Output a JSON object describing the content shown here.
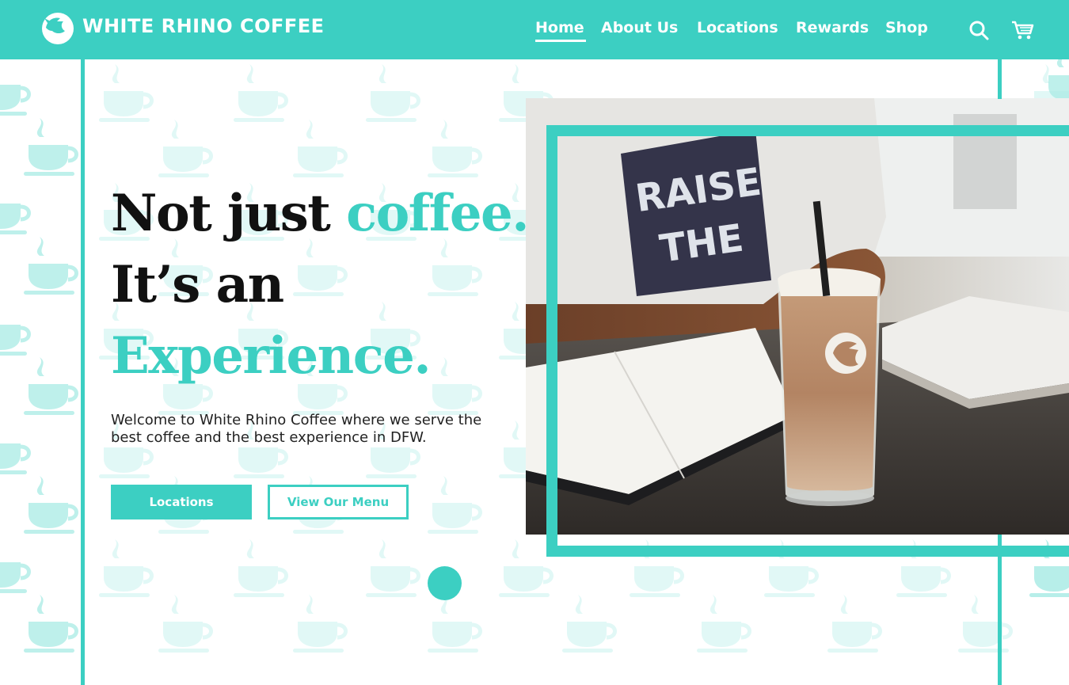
{
  "brand": {
    "name": "WHITE RHINO COFFEE",
    "accent_color": "#3ccfc2"
  },
  "nav": {
    "items": [
      {
        "label": "Home",
        "active": true
      },
      {
        "label": "About Us",
        "active": false
      },
      {
        "label": "Locations",
        "active": false
      },
      {
        "label": "Rewards",
        "active": false
      },
      {
        "label": "Shop",
        "active": false
      }
    ],
    "icons": [
      "search-icon",
      "cart-icon"
    ]
  },
  "hero": {
    "line1_dark": "Not just ",
    "line1_teal": "coffee.",
    "line2_dark": "It’s an",
    "line3_teal": "Experience.",
    "intro": "Welcome to White Rhino Coffee where we serve the best coffee and the best experience in DFW.",
    "primary_button": "Locations",
    "secondary_button": "View Our Menu"
  },
  "photo": {
    "shirt_text_line1": "RAISE",
    "shirt_text_line2": "THE"
  }
}
